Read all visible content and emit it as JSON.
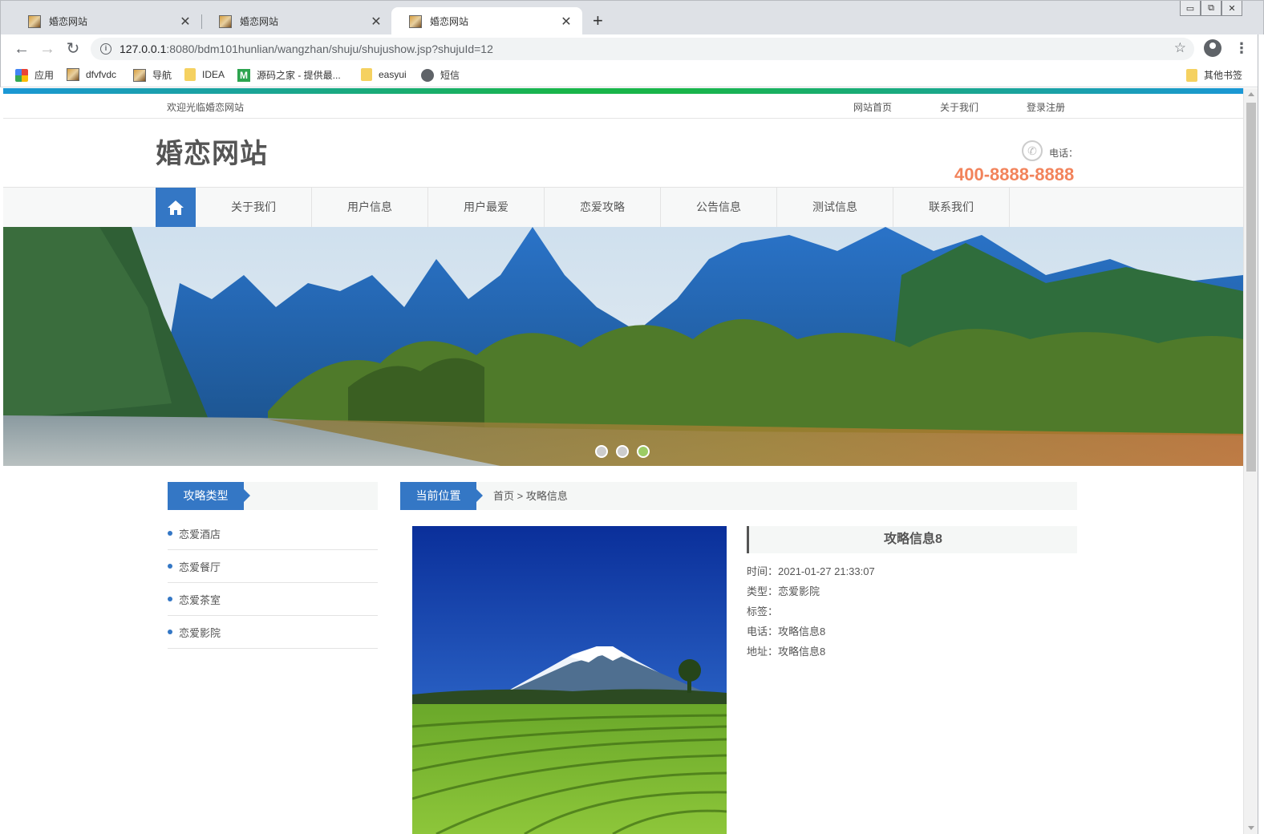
{
  "browser": {
    "tabs": [
      {
        "title": "婚恋网站",
        "close": "✕"
      },
      {
        "title": "婚恋网站",
        "close": "✕"
      },
      {
        "title": "婚恋网站",
        "close": "✕"
      }
    ],
    "new_tab": "+",
    "url_host": "127.0.0.1",
    "url_path": ":8080/bdm101hunlian/wangzhan/shuju/shujushow.jsp?shujuId=12",
    "bookmarks": [
      {
        "label": "应用",
        "icon": "apps-grid-icon"
      },
      {
        "label": "dfvfvdc",
        "icon": "page-icon"
      },
      {
        "label": "导航",
        "icon": "page-icon"
      },
      {
        "label": "IDEA",
        "icon": "folder-icon"
      },
      {
        "label": "源码之家 - 提供最...",
        "icon": "m-logo-icon"
      },
      {
        "label": "easyui",
        "icon": "folder-icon"
      },
      {
        "label": "短信",
        "icon": "globe-icon"
      }
    ],
    "other_bookmarks": "其他书签"
  },
  "site": {
    "welcome": "欢迎光临婚恋网站",
    "top_links": [
      "网站首页",
      "关于我们",
      "登录注册"
    ],
    "logo": "婚恋网站",
    "phone_label": "电话：",
    "phone_number": "400-8888-8888",
    "nav": [
      "关于我们",
      "用户信息",
      "用户最爱",
      "恋爱攻略",
      "公告信息",
      "测试信息",
      "联系我们"
    ],
    "slides": 3,
    "active_slide": 3
  },
  "sidebar": {
    "title": "攻略类型",
    "items": [
      "恋爱酒店",
      "恋爱餐厅",
      "恋爱茶室",
      "恋爱影院"
    ]
  },
  "breadcrumb": {
    "label": "当前位置",
    "path": "首页 > 攻略信息"
  },
  "detail": {
    "title": "攻略信息8",
    "time": "时间：2021-01-27 21:33:07",
    "type": "类型：恋爱影院",
    "tags": "标签：",
    "phone": "电话：攻略信息8",
    "address": "地址：攻略信息8"
  },
  "colors": {
    "accent": "#3477c5",
    "phone": "#f2835b",
    "topline_blue": "#1a97d5",
    "topline_green": "#19b54a"
  }
}
